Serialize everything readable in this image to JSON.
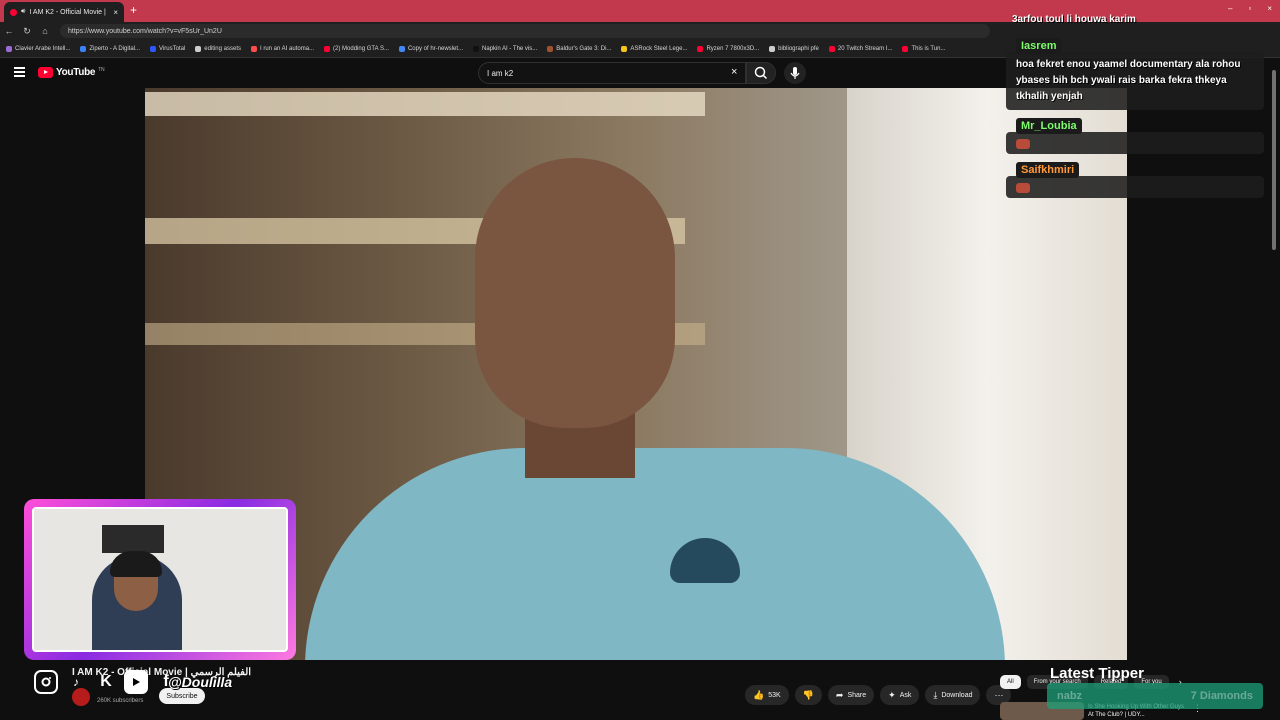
{
  "browser": {
    "tab_title": "I AM K2 - Official Movie | ...الفيلم",
    "tab_close": "×",
    "new_tab": "+",
    "url": "https://www.youtube.com/watch?v=vF5sUr_Un2U",
    "window_controls": [
      "–",
      "▫",
      "×"
    ],
    "bookmarks": [
      {
        "label": "Clavier Arabe Intell...",
        "color": "#9b6bd6"
      },
      {
        "label": "Ziperto - A Digital...",
        "color": "#3b82f6"
      },
      {
        "label": "VirusTotal",
        "color": "#2f57ff"
      },
      {
        "label": "editing assets",
        "color": "#cccccc"
      },
      {
        "label": "I run an AI automa...",
        "color": "#ff4d4d"
      },
      {
        "label": "(2) Modding GTA S...",
        "color": "#ff0033"
      },
      {
        "label": "Copy of hr-newslet...",
        "color": "#4285f4"
      },
      {
        "label": "Napkin AI - The vis...",
        "color": "#111111"
      },
      {
        "label": "Baldur's Gate 3: Di...",
        "color": "#a0522d"
      },
      {
        "label": "ASRock Steel Lege...",
        "color": "#f5c518"
      },
      {
        "label": "Ryzen 7 7800x3D...",
        "color": "#ff0033"
      },
      {
        "label": "bibliographi pfe",
        "color": "#cccccc"
      },
      {
        "label": "20 Twitch Stream I...",
        "color": "#ff0033"
      },
      {
        "label": "This is Tun...",
        "color": "#ff0033"
      }
    ]
  },
  "youtube": {
    "logo": "YouTube",
    "logo_sup": "TN",
    "search_value": "I am k2",
    "search_clear": "×",
    "video_title": "I AM K2 - Official Movie | الفيلم الرسمي",
    "subscribers": "260K subscribers",
    "subscribe_label": "Subscribe",
    "actions": [
      {
        "label": "53K",
        "icon": "👍",
        "name": "like"
      },
      {
        "label": "",
        "icon": "👎",
        "name": "dislike"
      },
      {
        "label": "Share",
        "icon": "➦",
        "name": "share"
      },
      {
        "label": "Ask",
        "icon": "✦",
        "name": "ask"
      },
      {
        "label": "Download",
        "icon": "⤓",
        "name": "download"
      },
      {
        "label": "",
        "icon": "⋯",
        "name": "more"
      }
    ],
    "chips": [
      "All",
      "From your search",
      "Related",
      "For you"
    ],
    "chip_next": "›",
    "recommendation_title": "Is She Hooking Up With Other Guys At The Club? | UDY...",
    "recommendation_more": "⋮"
  },
  "overlay": {
    "handle": "@Doulilla",
    "social_icons": [
      "instagram-icon",
      "tiktok-icon",
      "kick-icon",
      "youtube-icon",
      "facebook-icon"
    ],
    "chat": [
      {
        "name": "",
        "text": "3arfou toul li houwa karim",
        "color": "#ffffff"
      },
      {
        "name": "Iasrem",
        "text": "hoa fekret enou yaamel documentary ala rohou ybases bih bch ywali rais barka fekra thkeya tkhalih yenjah",
        "color": "#7cfc6a"
      },
      {
        "name": "Mr_Loubia",
        "text": "",
        "color": "#7cfc6a"
      },
      {
        "name": "Saifkhmiri",
        "text": "",
        "color": "#ff9a3c"
      }
    ],
    "latest_tipper_label": "Latest Tipper",
    "tipper_name": "nabz",
    "tipper_amount": "7 Diamonds"
  },
  "colors": {
    "youtube_red": "#ff0033",
    "tab_bar": "#c2384c",
    "webcam_border": "#ff4fd8"
  }
}
